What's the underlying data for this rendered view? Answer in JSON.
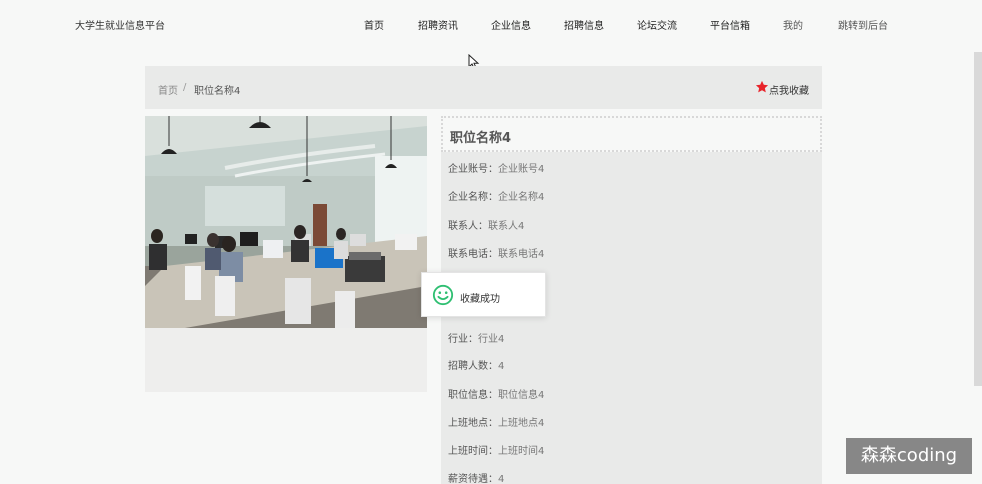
{
  "header": {
    "site_title": "大学生就业信息平台",
    "nav": [
      {
        "label": "首页"
      },
      {
        "label": "招聘资讯"
      },
      {
        "label": "企业信息"
      },
      {
        "label": "招聘信息"
      },
      {
        "label": "论坛交流"
      },
      {
        "label": "平台信箱"
      },
      {
        "label": "我的"
      },
      {
        "label": "跳转到后台"
      }
    ]
  },
  "breadcrumb": {
    "home": "首页",
    "separator": "/",
    "current": "职位名称4"
  },
  "favorite": {
    "label": "点我收藏",
    "star_color": "#e8232a",
    "icon": "star-icon"
  },
  "detail": {
    "title": "职位名称4",
    "fields_top": [
      {
        "key": "企业账号：",
        "value": "企业账号4"
      },
      {
        "key": "企业名称：",
        "value": "企业名称4"
      },
      {
        "key": "联系人：",
        "value": "联系人4"
      },
      {
        "key": "联系电话：",
        "value": "联系电话4"
      }
    ],
    "fields_bottom": [
      {
        "key": "行业：",
        "value": "行业4"
      },
      {
        "key": "招聘人数：",
        "value": "4"
      },
      {
        "key": "职位信息：",
        "value": "职位信息4"
      },
      {
        "key": "上班地点：",
        "value": "上班地点4"
      },
      {
        "key": "上班时间：",
        "value": "上班时间4"
      },
      {
        "key": "薪资待遇：",
        "value": "4"
      }
    ]
  },
  "toast": {
    "message": "收藏成功",
    "icon": "smile-icon",
    "icon_color": "#2fbf72"
  },
  "watermark": {
    "text": "森森coding"
  }
}
